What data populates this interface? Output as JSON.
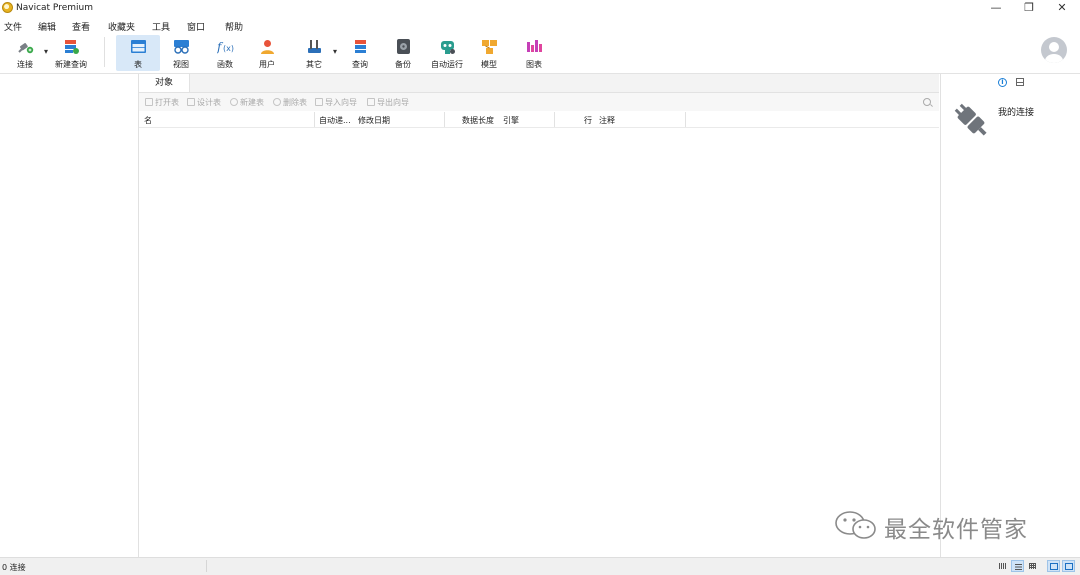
{
  "window": {
    "title": "Navicat Premium",
    "minimize_glyph": "—",
    "restore_glyph": "❐",
    "close_glyph": "✕"
  },
  "menu": [
    "文件",
    "编辑",
    "查看",
    "收藏夹",
    "工具",
    "窗口",
    "帮助"
  ],
  "toolbar": {
    "connect": "连接",
    "new_query": "新建查询",
    "table": "表",
    "view": "视图",
    "function": "函数",
    "user": "用户",
    "other": "其它",
    "query": "查询",
    "backup": "备份",
    "automation": "自动运行",
    "model": "模型",
    "chart": "图表",
    "dropdown_glyph": "▾"
  },
  "tabs": {
    "objects": "对象"
  },
  "object_toolbar": {
    "open_table": "打开表",
    "design_table": "设计表",
    "new_table": "新建表",
    "delete_table": "删除表",
    "import_wizard": "导入向导",
    "export_wizard": "导出向导"
  },
  "columns": [
    "名",
    "自动递...",
    "修改日期",
    "数据长度",
    "引擎",
    "行",
    "注释"
  ],
  "right_panel": {
    "info_glyph": "i",
    "connection_label": "我的连接"
  },
  "status": {
    "text": "0 连接"
  },
  "watermark": {
    "text": "最全软件管家"
  },
  "colors": {
    "accent": "#1b7fd6",
    "active_tool_bg": "#d8e8f8",
    "disabled_text": "#a8a8a8"
  },
  "icons": {
    "connect": "plug-connect-icon",
    "new_query": "new-query-icon",
    "table": "table-icon",
    "view": "view-glasses-icon",
    "function": "function-fx-icon",
    "user": "user-icon",
    "other": "tools-icon",
    "query": "query-icon",
    "backup": "backup-icon",
    "automation": "robot-icon",
    "model": "model-icon",
    "chart": "chart-icon",
    "info": "info-icon",
    "search": "search-icon",
    "avatar": "user-avatar-icon"
  }
}
